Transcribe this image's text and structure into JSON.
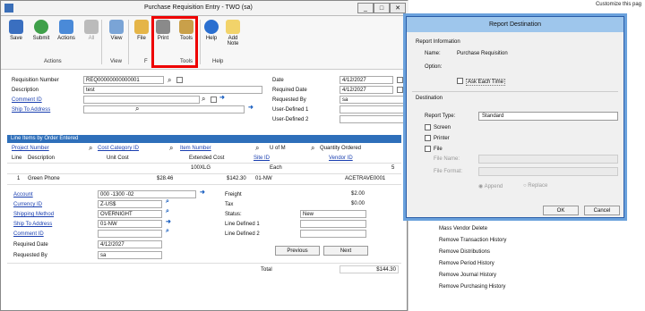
{
  "window": {
    "title": "Purchase Requisition Entry  -  TWO (sa)"
  },
  "background": {
    "hint": "Customize this pag",
    "items": [
      "Mass Vendor Delete",
      "Remove Transaction History",
      "Remove Distributions",
      "Remove Period History",
      "Remove Journal History",
      "Remove Purchasing History"
    ]
  },
  "ribbon": {
    "buttons": [
      {
        "label": "Save"
      },
      {
        "label": "Submit"
      },
      {
        "label": "Actions"
      },
      {
        "label": "All"
      },
      {
        "label": "View"
      },
      {
        "label": "File"
      },
      {
        "label": "Print"
      },
      {
        "label": "Tools"
      },
      {
        "label": "Help"
      },
      {
        "label": "Add\nNote"
      }
    ],
    "groups": [
      "Actions",
      "View",
      "F",
      "Tools",
      "Help"
    ]
  },
  "form": {
    "requisition_number_label": "Requisition Number",
    "requisition_number": "REQ00000000000001",
    "description_label": "Description",
    "description": "test",
    "comment_id_label": "Comment ID",
    "ship_to_label": "Ship To Address",
    "date_label": "Date",
    "date": "4/12/2027",
    "required_date_label": "Required Date",
    "required_date": "4/12/2027",
    "requested_by_label": "Requested By",
    "requested_by": "sa",
    "user_defined1_label": "User-Defined 1",
    "user_defined2_label": "User-Defined 2"
  },
  "grid": {
    "title": "Line Items by Order Entered",
    "hdr1": [
      "Project Number",
      "Cost Category ID",
      "Item Number",
      "U of M",
      "Quantity Ordered"
    ],
    "hdr2": [
      "Line",
      "Description",
      "Unit Cost",
      "Extended Cost",
      "Site ID",
      "Vendor ID"
    ],
    "row_top": [
      "100XLG",
      "Each",
      "5"
    ],
    "row": [
      "1",
      "Green Phone",
      "$28.46",
      "$142.30",
      "01-NW",
      "ACETRAVE0001"
    ]
  },
  "detail": {
    "account_label": "Account",
    "account": "000 -1300 -02",
    "currency_label": "Currency ID",
    "currency": "Z-US$",
    "shipping_label": "Shipping Method",
    "shipping": "OVERNIGHT",
    "shipto_label": "Ship To Address",
    "shipto": "01-NW",
    "comment_label": "Comment ID",
    "reqdate_label": "Required Date",
    "reqdate": "4/12/2027",
    "reqby_label": "Requested By",
    "reqby": "sa",
    "freight_label": "Freight",
    "freight": "$2.00",
    "tax_label": "Tax",
    "tax": "$0.00",
    "status_label": "Status:",
    "status": "New",
    "line_def1_label": "Line Defined 1",
    "line_def2_label": "Line Defined 2",
    "prev_button": "Previous",
    "next_button": "Next",
    "total_label": "Total",
    "total": "$144.30"
  },
  "dialog": {
    "title": "Report Destination",
    "info_header": "Report Information",
    "name_label": "Name:",
    "name": "Purchase Requisition",
    "option_label": "Option:",
    "ask_each_time": "Ask Each Time",
    "dest_header": "Destination",
    "report_type_label": "Report Type:",
    "report_type": "Standard",
    "screen": "Screen",
    "printer": "Printer",
    "file": "File",
    "file_name_label": "File Name:",
    "file_format_label": "File Format:",
    "append": "Append",
    "replace": "Replace",
    "ok": "OK",
    "cancel": "Cancel"
  },
  "colors": {
    "accent": "#2e6fba",
    "highlight": "#e00000",
    "dialog_title": "#9ec6ec"
  }
}
